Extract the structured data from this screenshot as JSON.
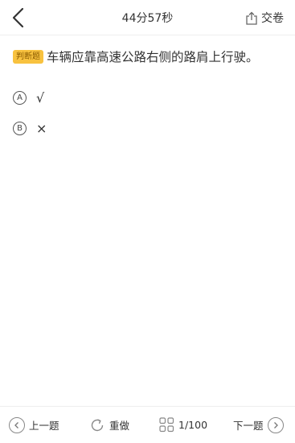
{
  "header": {
    "timer": "44分57秒",
    "submit_label": "交卷",
    "back_icon": "chevron-left-icon",
    "submit_icon": "share-upload-icon"
  },
  "question": {
    "type_badge": "判断题",
    "text": "车辆应靠高速公路右侧的路肩上行驶。",
    "badge_color": "#f8c23f"
  },
  "options": [
    {
      "letter": "A",
      "text": "√"
    },
    {
      "letter": "B",
      "text": "×"
    }
  ],
  "footer": {
    "prev_label": "上一题",
    "redo_label": "重做",
    "progress": "1/100",
    "next_label": "下一题"
  }
}
